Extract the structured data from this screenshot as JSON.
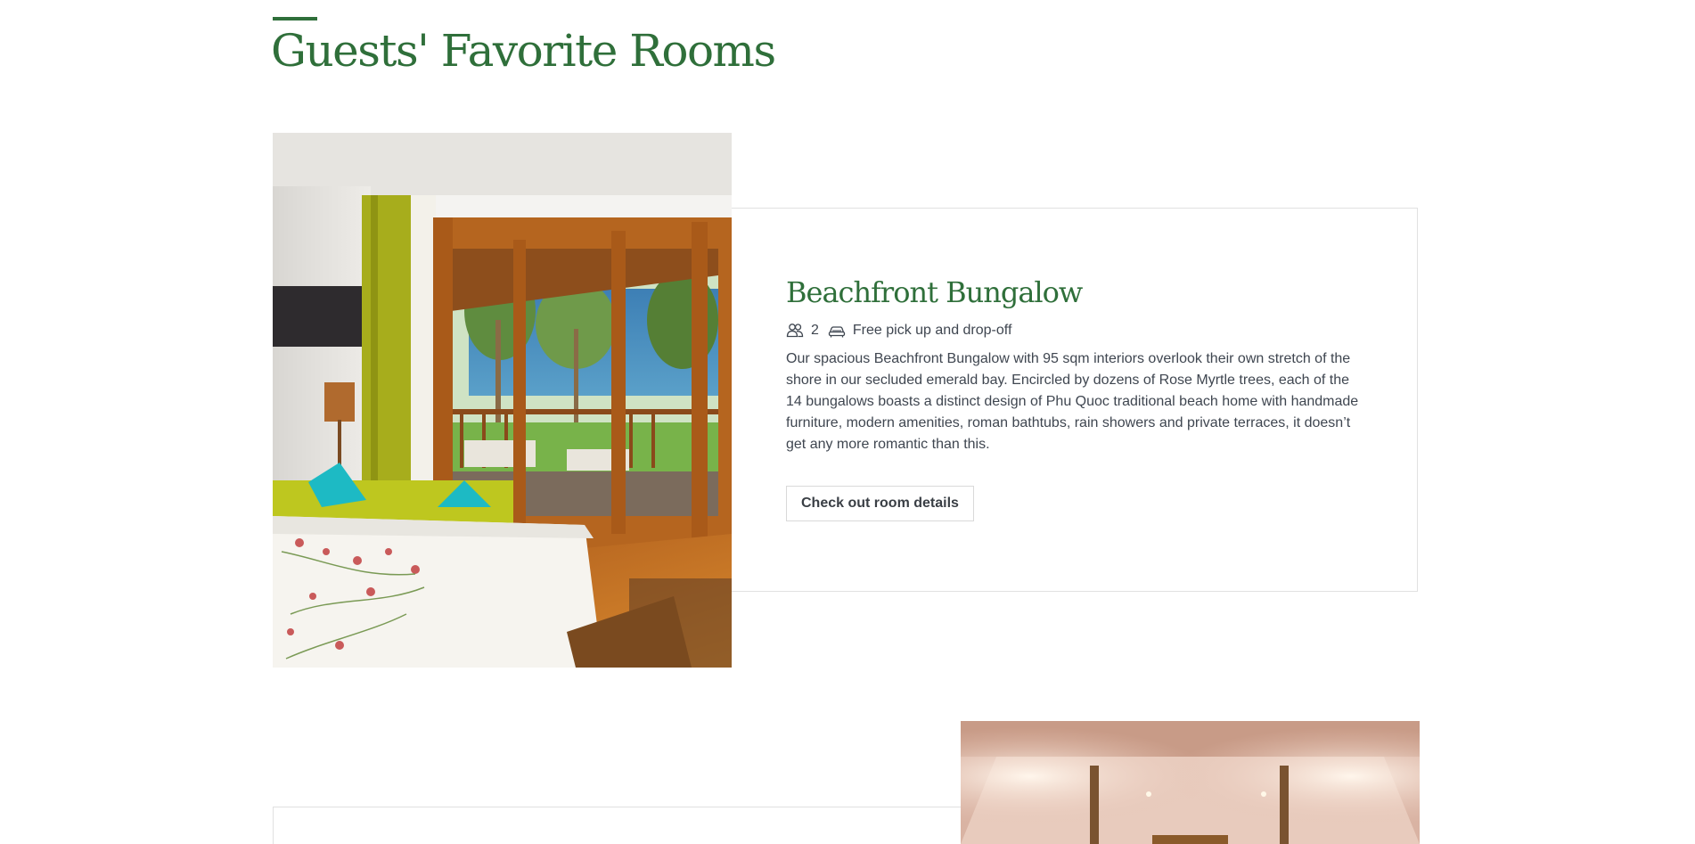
{
  "section": {
    "title": "Guests' Favorite Rooms"
  },
  "rooms": [
    {
      "name": "Beachfront Bungalow",
      "guests": "2",
      "transfer": "Free pick up and drop-off",
      "description": "Our spacious Beachfront Bungalow with 95 sqm interiors overlook their own stretch of the shore in our secluded emerald bay. Encircled by dozens of Rose Myrtle trees, each of the 14 bungalows boasts a distinct design of Phu Quoc traditional beach home with handmade furniture, modern amenities, roman bathtubs, rain showers and private terraces, it doesn’t get any more romantic than this.",
      "button_label": "Check out room details"
    }
  ],
  "icons": {
    "guests": "guests-icon",
    "transfer": "car-icon"
  },
  "colors": {
    "brand_green": "#2f6f3a",
    "text": "#3f4650",
    "border": "#e1e1e1"
  }
}
